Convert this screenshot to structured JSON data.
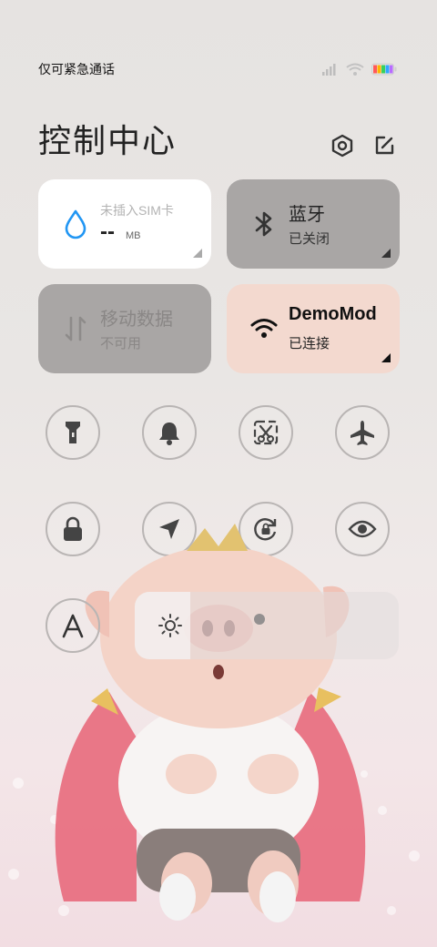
{
  "status_bar": {
    "carrier_text": "仅可紧急通话",
    "icons": [
      "signal-icon",
      "wifi-icon",
      "battery-icon"
    ],
    "battery_colors": [
      "#ff5a5a",
      "#ffb400",
      "#37d15d",
      "#2fa7ff",
      "#b86cff"
    ]
  },
  "header": {
    "title": "控制中心",
    "settings_icon": "settings-hex-icon",
    "edit_icon": "edit-icon"
  },
  "cards": {
    "data_usage": {
      "label": "未插入SIM卡",
      "value": "--",
      "unit": "MB",
      "icon": "water-drop-icon",
      "accent": "#2196f3"
    },
    "bluetooth": {
      "label": "蓝牙",
      "status": "已关闭",
      "icon": "bluetooth-icon"
    },
    "mobile_data": {
      "label": "移动数据",
      "status": "不可用",
      "icon": "data-arrows-icon"
    },
    "wifi": {
      "label": "DemoMod",
      "status": "已连接",
      "icon": "wifi-icon"
    }
  },
  "toggles": [
    {
      "name": "flashlight-toggle",
      "icon": "flashlight-icon"
    },
    {
      "name": "ring-toggle",
      "icon": "bell-icon"
    },
    {
      "name": "screenshot-toggle",
      "icon": "scissors-icon"
    },
    {
      "name": "airplane-toggle",
      "icon": "airplane-icon"
    },
    {
      "name": "lock-screen-toggle",
      "icon": "lock-icon"
    },
    {
      "name": "location-toggle",
      "icon": "location-arrow-icon"
    },
    {
      "name": "rotation-lock-toggle",
      "icon": "rotation-lock-icon"
    },
    {
      "name": "reading-mode-toggle",
      "icon": "eye-icon"
    },
    {
      "name": "auto-brightness-toggle",
      "icon": "letter-a-icon"
    }
  ],
  "brightness": {
    "icon": "sun-icon",
    "level": 0.21
  },
  "colors": {
    "card_white": "#ffffff",
    "card_gray": "#a9a6a5",
    "card_wifi": "#f3d9cf",
    "icon_dark": "#333333"
  }
}
